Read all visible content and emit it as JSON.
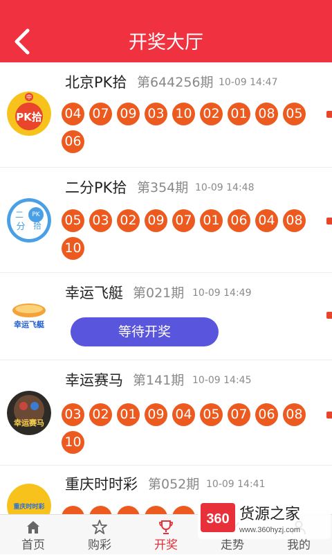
{
  "header": {
    "title": "开奖大厅"
  },
  "games": [
    {
      "name": "北京PK拾",
      "period": "第644256期",
      "time": "10-09 14:47",
      "balls": [
        "04",
        "07",
        "09",
        "03",
        "10",
        "02",
        "01",
        "08",
        "05",
        "06"
      ],
      "logo_text": "PK拾",
      "logo_top": "中"
    },
    {
      "name": "二分PK拾",
      "period": "第354期",
      "time": "10-09 14:48",
      "balls": [
        "05",
        "03",
        "02",
        "09",
        "07",
        "01",
        "06",
        "04",
        "08",
        "10"
      ],
      "logo_text_a": "二",
      "logo_text_b": "分",
      "logo_text_c": "PK",
      "logo_text_d": "拾"
    },
    {
      "name": "幸运飞艇",
      "period": "第021期",
      "time": "10-09 14:49",
      "status": "等待开奖",
      "logo_text": "幸运飞艇"
    },
    {
      "name": "幸运赛马",
      "period": "第141期",
      "time": "10-09 14:45",
      "balls": [
        "03",
        "02",
        "01",
        "09",
        "04",
        "05",
        "07",
        "06",
        "08",
        "10"
      ],
      "logo_text": "幸运赛马"
    },
    {
      "name": "重庆时时彩",
      "period": "第052期",
      "time": "10-09 14:41",
      "logo_text": "重庆时时彩"
    }
  ],
  "tabs": [
    {
      "label": "首页",
      "icon": "home-icon"
    },
    {
      "label": "购彩",
      "icon": "star-icon"
    },
    {
      "label": "开奖",
      "icon": "trophy-icon"
    },
    {
      "label": "走势",
      "icon": "trend-icon"
    },
    {
      "label": "我的",
      "icon": "user-icon"
    }
  ],
  "active_tab": "开奖",
  "watermark": {
    "brand": "360",
    "name": "货源之家",
    "url": "www.360hyzj.com"
  },
  "colors": {
    "header": "#f0313f",
    "ball": "#ec5a1f",
    "wait_button": "#5a55dd",
    "active_tab": "#e8303b"
  }
}
